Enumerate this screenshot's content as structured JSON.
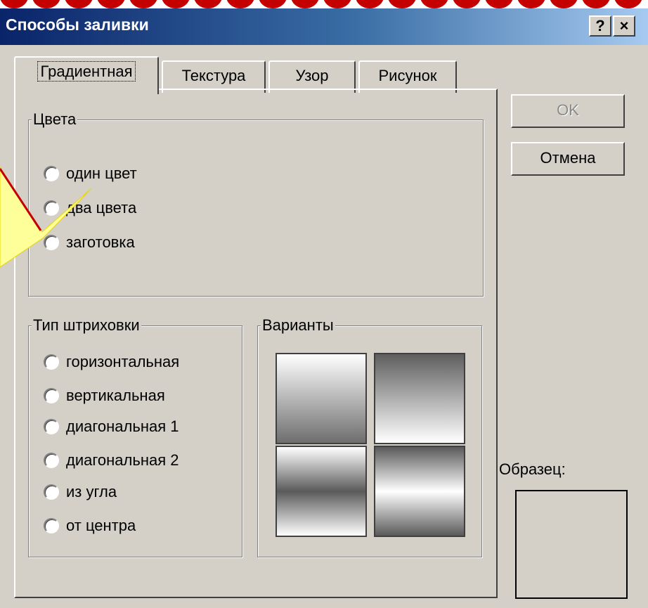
{
  "window": {
    "title": "Способы заливки",
    "help_button": "?",
    "close_button": "×"
  },
  "tabs": [
    "Градиентная",
    "Текстура",
    "Узор",
    "Рисунок"
  ],
  "colors_group": {
    "label": "Цвета",
    "options": [
      "один цвет",
      "два цвета",
      "заготовка"
    ]
  },
  "shading_group": {
    "label": "Тип штриховки",
    "options": [
      "горизонтальная",
      "вертикальная",
      "диагональная 1",
      "диагональная 2",
      "из угла",
      "от центра"
    ]
  },
  "variants_group": {
    "label": "Варианты"
  },
  "buttons": {
    "ok": "OK",
    "cancel": "Отмена"
  },
  "sample": {
    "label": "Образец:"
  },
  "colors": {
    "title_start": "#0a246a",
    "title_end": "#a6caf0",
    "dialog_bg": "#d4d0c8",
    "accent_red": "#c40000"
  }
}
